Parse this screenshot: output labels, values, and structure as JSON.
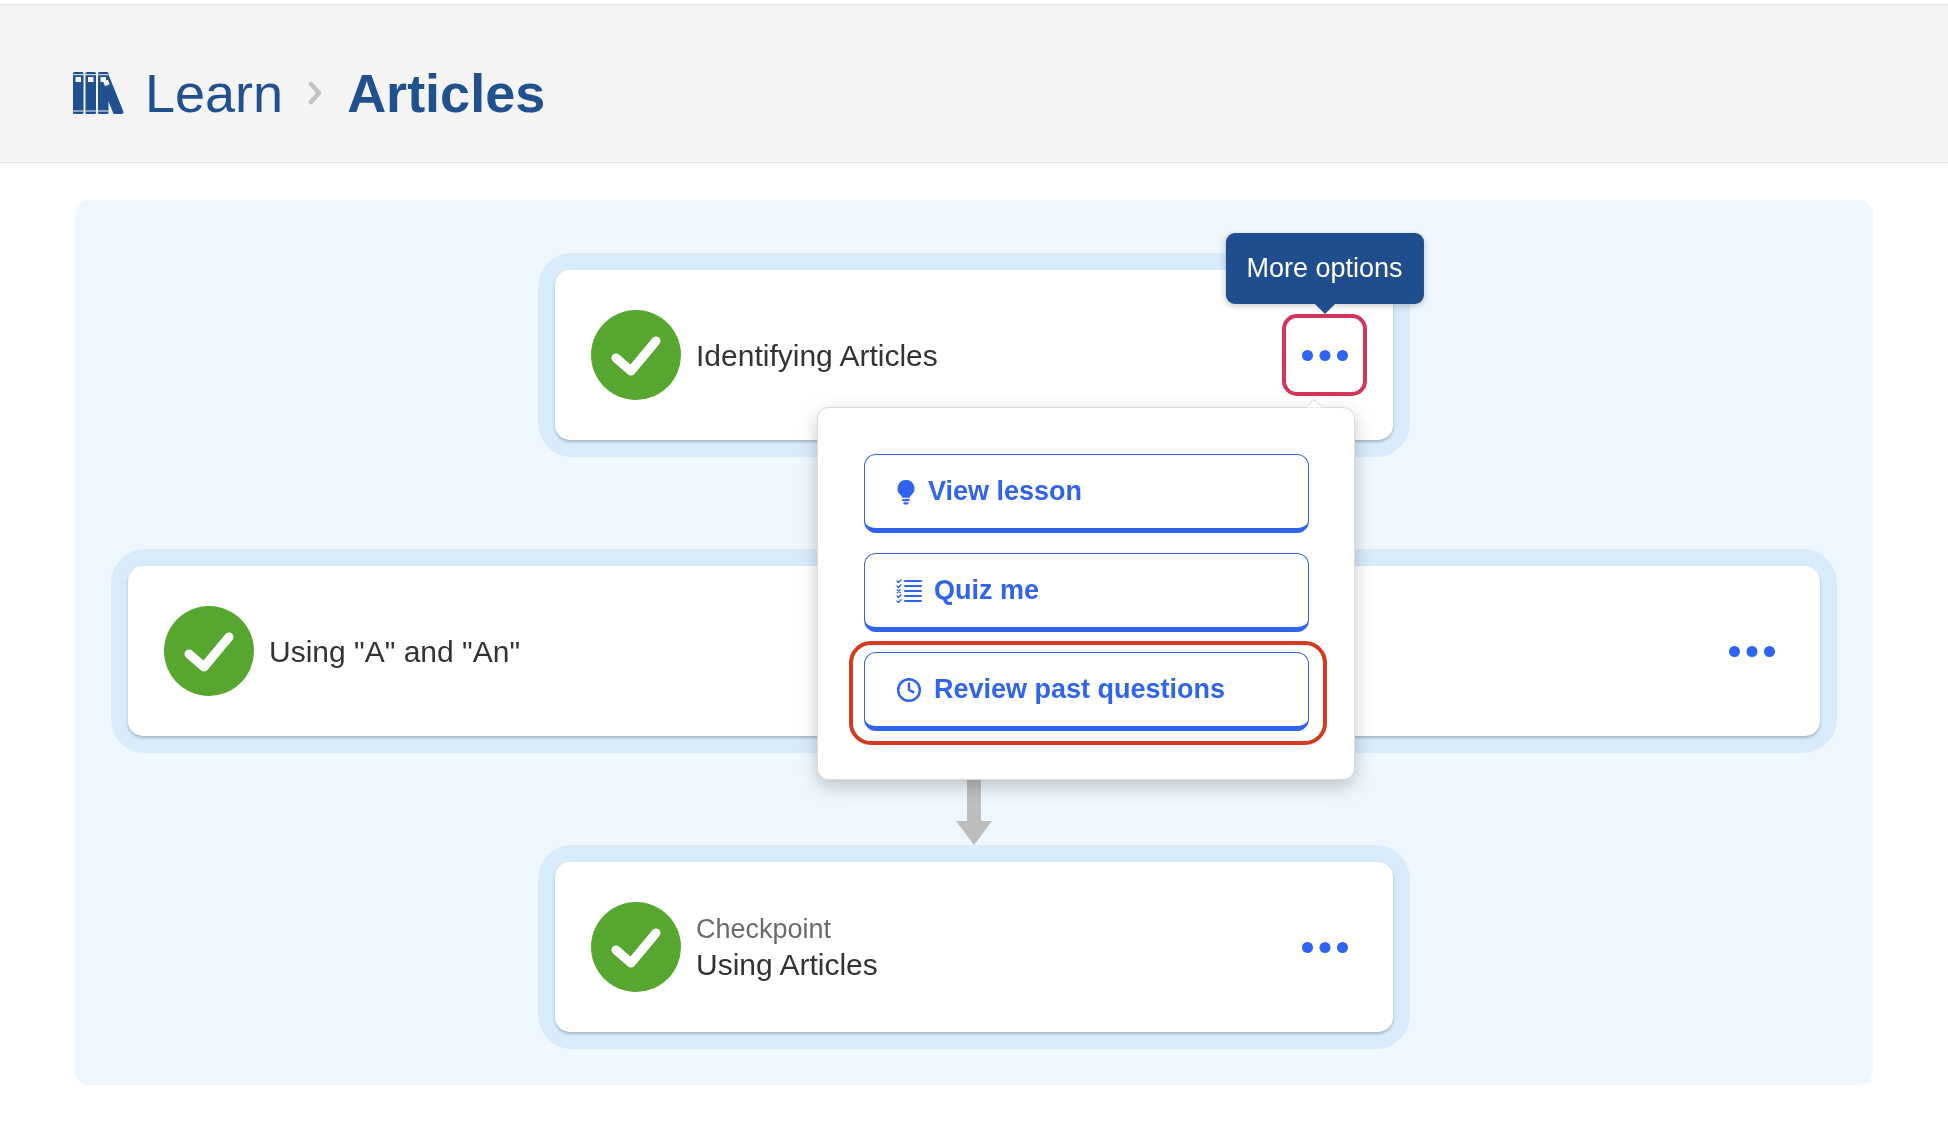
{
  "breadcrumb": {
    "parent": "Learn",
    "current": "Articles"
  },
  "path": [
    {
      "kind": "lesson",
      "title": "Identifying Articles",
      "completed": true,
      "options_focused": true,
      "tooltip": "More options",
      "menu": [
        {
          "kind": "lesson",
          "label": "View lesson",
          "highlighted": false
        },
        {
          "kind": "quiz",
          "label": "Quiz me",
          "highlighted": false
        },
        {
          "kind": "review",
          "label": "Review past questions",
          "highlighted": true
        }
      ]
    },
    {
      "kind": "lesson",
      "title": "Using \"A\" and \"An\"",
      "completed": true,
      "options_focused": false
    },
    {
      "kind": "checkpoint",
      "label": "Checkpoint",
      "title": "Using Articles",
      "completed": true,
      "options_focused": false
    }
  ]
}
